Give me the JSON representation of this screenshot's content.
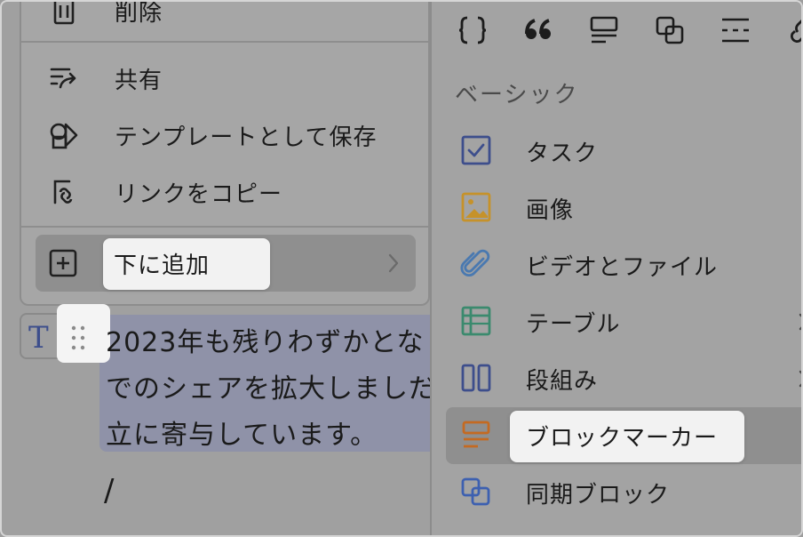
{
  "context_menu": {
    "items": [
      {
        "label": "削除",
        "icon": "trash-icon"
      },
      {
        "label": "共有",
        "icon": "share-icon"
      },
      {
        "label": "テンプレートとして保存",
        "icon": "template-icon"
      },
      {
        "label": "リンクをコピー",
        "icon": "copy-link-icon"
      }
    ],
    "add_below": {
      "label": "下に追加",
      "icon": "plus-square-icon"
    }
  },
  "editor": {
    "block_type_icon": "T",
    "paragraph_lines": [
      "2023年も残りわずかとな",
      "でのシェアを拡大しましだ",
      "立に寄与しています。"
    ],
    "slash_text": "/"
  },
  "block_menu": {
    "toolbar_icons": [
      "code-block-icon",
      "quote-icon",
      "callout-icon",
      "synced-block-icon",
      "divider-icon",
      "link-icon"
    ],
    "section_title": "ベーシック",
    "items": [
      {
        "label": "タスク",
        "icon": "checkbox-icon",
        "color": "#3d4e8c"
      },
      {
        "label": "画像",
        "icon": "image-icon",
        "color": "#c6922a"
      },
      {
        "label": "ビデオとファイル",
        "icon": "paperclip-icon",
        "color": "#4a79b0"
      },
      {
        "label": "テーブル",
        "icon": "table-icon",
        "color": "#3b8a6e"
      },
      {
        "label": "段組み",
        "icon": "columns-icon",
        "color": "#3d4e8c"
      },
      {
        "label": "ブロックマーカー",
        "icon": "block-marker-icon",
        "color": "#c46a22"
      },
      {
        "label": "同期ブロック",
        "icon": "synced-block-icon",
        "color": "#3d60b0"
      }
    ]
  }
}
